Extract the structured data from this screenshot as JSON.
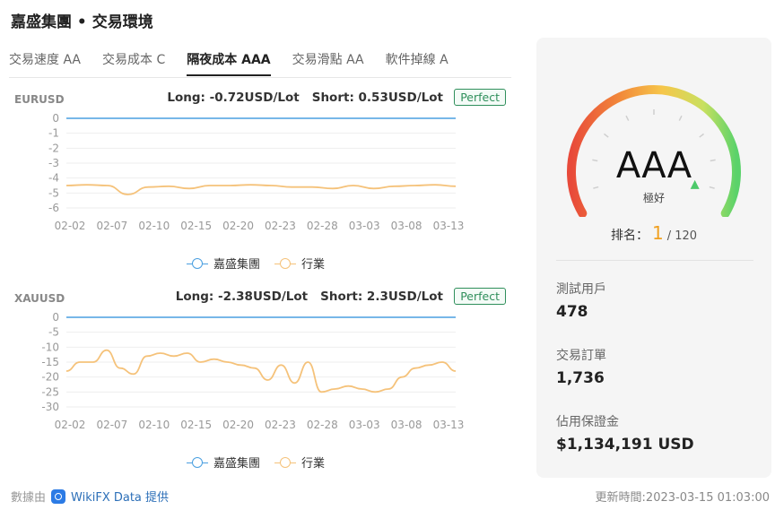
{
  "title": "嘉盛集團 • 交易環境",
  "tabs": [
    {
      "label": "交易速度 AA"
    },
    {
      "label": "交易成本 C"
    },
    {
      "label": "隔夜成本 AAA",
      "active": true
    },
    {
      "label": "交易滑點 AA"
    },
    {
      "label": "軟件掉線 A"
    }
  ],
  "charts": [
    {
      "symbol": "EURUSD",
      "long": "Long: -0.72USD/Lot",
      "short": "Short: 0.53USD/Lot",
      "badge": "Perfect"
    },
    {
      "symbol": "XAUUSD",
      "long": "Long: -2.38USD/Lot",
      "short": "Short: 2.3USD/Lot",
      "badge": "Perfect"
    }
  ],
  "legend": {
    "company": "嘉盛集團",
    "industry": "行業"
  },
  "colors": {
    "company": "#4a9fe0",
    "industry": "#f5c27a",
    "perfect": "#2f8f5b",
    "rank": "#f0a020"
  },
  "chart_data": [
    {
      "type": "line",
      "title": "EURUSD",
      "categories": [
        "02-02",
        "02-07",
        "02-10",
        "02-15",
        "02-20",
        "02-23",
        "02-28",
        "03-03",
        "03-08",
        "03-13"
      ],
      "ylim": [
        -6,
        0
      ],
      "yticks": [
        0,
        -1,
        -2,
        -3,
        -4,
        -5,
        -6
      ],
      "series": [
        {
          "name": "嘉盛集團",
          "values": [
            0,
            0,
            0,
            0,
            0,
            0,
            0,
            0,
            0,
            0,
            0,
            0,
            0,
            0,
            0,
            0,
            0,
            0,
            0,
            0
          ]
        },
        {
          "name": "行業",
          "values": [
            -4.5,
            -4.45,
            -4.5,
            -5.1,
            -4.6,
            -4.55,
            -4.7,
            -4.5,
            -4.5,
            -4.45,
            -4.5,
            -4.6,
            -4.6,
            -4.7,
            -4.5,
            -4.7,
            -4.55,
            -4.5,
            -4.45,
            -4.55
          ]
        }
      ]
    },
    {
      "type": "line",
      "title": "XAUUSD",
      "categories": [
        "02-02",
        "02-07",
        "02-10",
        "02-15",
        "02-20",
        "02-23",
        "02-28",
        "03-03",
        "03-08",
        "03-13"
      ],
      "ylim": [
        -30,
        0
      ],
      "yticks": [
        0,
        -5,
        -10,
        -15,
        -20,
        -25,
        -30
      ],
      "series": [
        {
          "name": "嘉盛集團",
          "values": [
            0,
            0,
            0,
            0,
            0,
            0,
            0,
            0,
            0,
            0,
            0,
            0,
            0,
            0,
            0,
            0,
            0,
            0,
            0,
            0,
            0,
            0,
            0,
            0,
            0,
            0,
            0,
            0,
            0,
            0
          ]
        },
        {
          "name": "行業",
          "values": [
            -18,
            -15,
            -15,
            -11,
            -17,
            -19,
            -13,
            -12,
            -13,
            -12,
            -15,
            -14,
            -15,
            -16,
            -17,
            -21,
            -16,
            -22,
            -15,
            -25,
            -24,
            -23,
            -24,
            -25,
            -24,
            -20,
            -17,
            -16,
            -15,
            -18
          ]
        }
      ]
    }
  ],
  "panel": {
    "grade": "AAA",
    "grade_label": "極好",
    "rank_label": "排名：",
    "rank": "1",
    "rank_total": "/ 120",
    "gauge_level": 0.95,
    "stats": [
      {
        "label": "測試用戶",
        "value": "478"
      },
      {
        "label": "交易訂單",
        "value": "1,736"
      },
      {
        "label": "佔用保證金",
        "value": "$1,134,191 USD"
      }
    ]
  },
  "footer": {
    "source_prefix": "數據由",
    "source_name": "WikiFX Data 提供",
    "updated": "更新時間:2023-03-15 01:03:00"
  }
}
